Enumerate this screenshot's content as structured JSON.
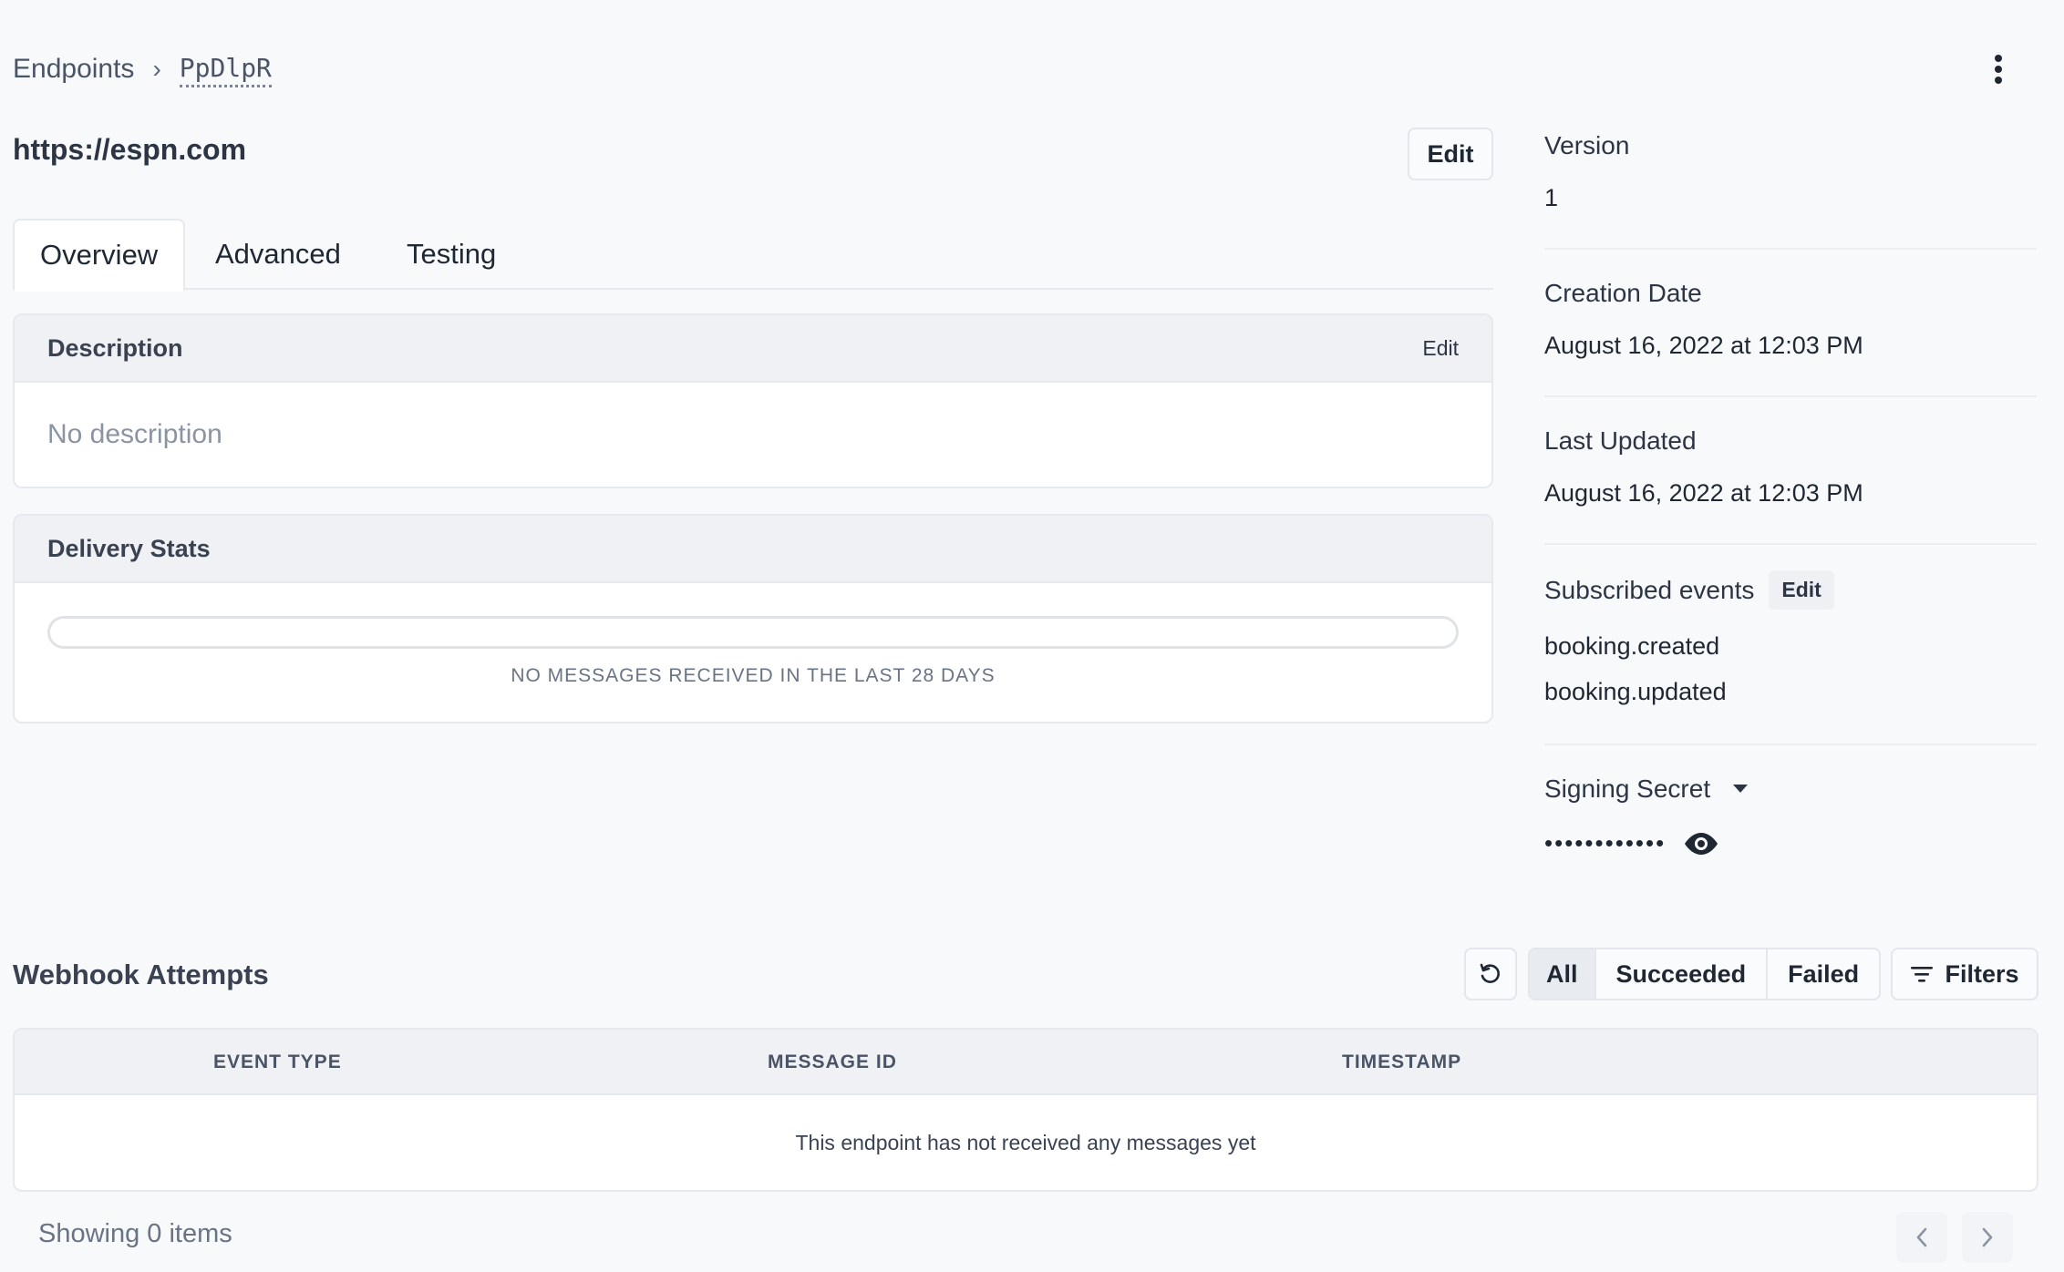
{
  "breadcrumb": {
    "root": "Endpoints",
    "separator": "›",
    "current": "PpDlpR"
  },
  "endpoint": {
    "url": "https://espn.com",
    "edit_label": "Edit"
  },
  "tabs": [
    {
      "label": "Overview",
      "active": true
    },
    {
      "label": "Advanced",
      "active": false
    },
    {
      "label": "Testing",
      "active": false
    }
  ],
  "description": {
    "title": "Description",
    "edit_label": "Edit",
    "text": "No description"
  },
  "delivery_stats": {
    "title": "Delivery Stats",
    "success_fraction": 0,
    "note": "NO MESSAGES RECEIVED IN THE LAST 28 DAYS"
  },
  "meta": {
    "version_label": "Version",
    "version_value": "1",
    "creation_label": "Creation Date",
    "creation_value": "August 16, 2022 at 12:03 PM",
    "updated_label": "Last Updated",
    "updated_value": "August 16, 2022 at 12:03 PM",
    "subscribed_label": "Subscribed events",
    "subscribed_edit": "Edit",
    "events": [
      "booking.created",
      "booking.updated"
    ],
    "secret_label": "Signing Secret",
    "secret_masked": "••••••••••••"
  },
  "attempts": {
    "title": "Webhook Attempts",
    "filters": [
      "All",
      "Succeeded",
      "Failed"
    ],
    "filters_button": "Filters",
    "columns": [
      "EVENT TYPE",
      "MESSAGE ID",
      "TIMESTAMP"
    ],
    "empty_text": "This endpoint has not received any messages yet",
    "showing": "Showing 0 items"
  },
  "icons": {
    "kebab": "more-vertical-icon",
    "refresh": "refresh-icon",
    "filter": "filter-icon",
    "eye": "eye-icon",
    "caret": "caret-down-icon",
    "prev": "chevron-left-icon",
    "next": "chevron-right-icon"
  },
  "colors": {
    "background": "#f8f9fb",
    "card_header": "#eff1f5",
    "border": "#e6e9ee"
  }
}
